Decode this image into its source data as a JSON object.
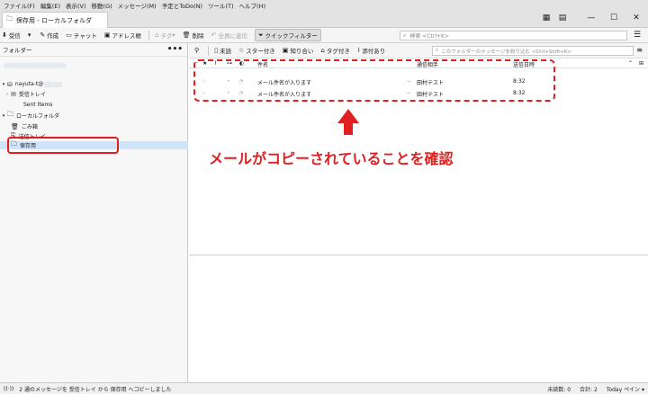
{
  "menubar": [
    "ファイル(F)",
    "編集(E)",
    "表示(V)",
    "移動(G)",
    "メッセージ(M)",
    "予定とToDo(N)",
    "ツール(T)",
    "ヘルプ(H)"
  ],
  "window": {
    "tab_title": "保存用 - ローカルフォルダ",
    "minimize": "—",
    "maximize": "☐",
    "close": "✕"
  },
  "toolbar": {
    "receive": "受信",
    "compose": "作成",
    "chat": "チャット",
    "address_book": "アドレス帳",
    "tag": "タグ",
    "delete": "削除",
    "reply_all": "全員に返信",
    "quick_filter": "クイックフィルター",
    "search_placeholder": "検索 <Ctrl+K>"
  },
  "folder_pane": {
    "header": "フォルダー",
    "account": "nayuta-t@",
    "inbox": "受信トレイ",
    "sent_items": "Sent Items",
    "local_folders": "ローカルフォルダ",
    "trash": "ごみ箱",
    "sent": "送信トレイ",
    "saved": "保存用"
  },
  "quick_filter": {
    "unread": "未読",
    "starred": "スター付き",
    "contacts": "知り合い",
    "tagged": "タグ付き",
    "attachment": "添付あり",
    "filter_placeholder": "このフォルダーのメッセージを絞り込む <Ctrl+Shift+K>"
  },
  "columns": {
    "subject": "件名",
    "correspondent": "通信相手",
    "date": "送信日時"
  },
  "messages": [
    {
      "subject": "メール件名が入ります",
      "correspondent": "田村テスト",
      "date": "8:32"
    },
    {
      "subject": "メール件名が入ります",
      "correspondent": "田村テスト",
      "date": "8:32"
    }
  ],
  "annotation": "メールがコピーされていることを確認",
  "status": {
    "message": "2 通のメッセージを 受信トレイ から 保存用 へコピーしました",
    "unread": "未読数: 0",
    "total": "合計: 2",
    "today_pane": "Today ペイン"
  },
  "colors": {
    "annotation_red": "#e02020",
    "selected_bg": "#cde4fb"
  }
}
